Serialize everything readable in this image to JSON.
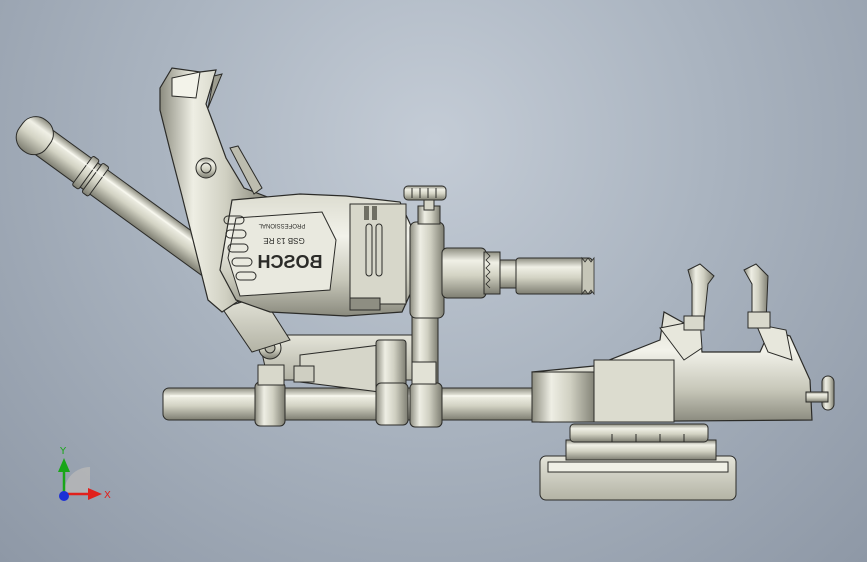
{
  "model": {
    "brand_text": "BOSCH",
    "model_text": "GSB 13 RE",
    "series_text": "PROFESSIONAL"
  },
  "triad": {
    "x_label": "X",
    "y_label": "Y",
    "x_color": "#e0201c",
    "y_color": "#19a619",
    "z_color": "#1b2fd6"
  },
  "colors": {
    "metal_light": "#e8e8dc",
    "metal_mid": "#c9c9b9",
    "metal_dark": "#8f8f82",
    "outline": "#2b2b28"
  }
}
